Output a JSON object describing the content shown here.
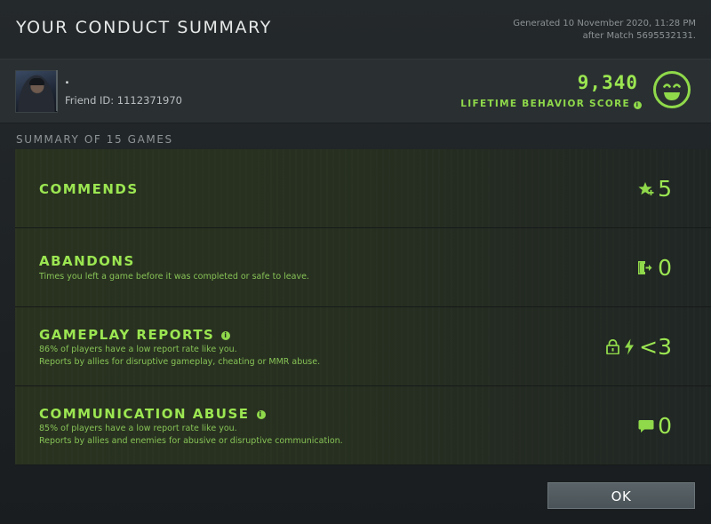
{
  "header": {
    "title": "YOUR CONDUCT SUMMARY",
    "generated_line1": "Generated 10 November 2020, 11:28 PM",
    "generated_line2": "after Match 5695532131."
  },
  "profile": {
    "username": ".",
    "friend_id": "Friend ID: 1112371970",
    "score": "9,340",
    "score_label": "LIFETIME BEHAVIOR SCORE",
    "info_glyph": "i"
  },
  "summary": {
    "heading": "SUMMARY OF 15 GAMES"
  },
  "rows": {
    "commends": {
      "title": "COMMENDS",
      "value": "5",
      "icon": "star-plus-icon"
    },
    "abandons": {
      "title": "ABANDONS",
      "desc": "Times you left a game before it was completed or safe to leave.",
      "value": "0",
      "icon": "exit-door-icon"
    },
    "gameplay_reports": {
      "title": "GAMEPLAY REPORTS",
      "desc1": "86% of players have a low report rate like you.",
      "desc2": "Reports by allies for disruptive gameplay, cheating or MMR abuse.",
      "value": "<3",
      "icons": [
        "lock-icon",
        "lightning-icon"
      ]
    },
    "communication_abuse": {
      "title": "COMMUNICATION ABUSE",
      "desc1": "85% of players have a low report rate like you.",
      "desc2": "Reports by allies and enemies for abusive or disruptive communication.",
      "value": "0",
      "icon": "speech-bubble-icon"
    }
  },
  "footer": {
    "ok_label": "OK"
  },
  "colors": {
    "accent_green": "#9be651",
    "desc_green": "#86c255",
    "background": "#1e2224"
  }
}
